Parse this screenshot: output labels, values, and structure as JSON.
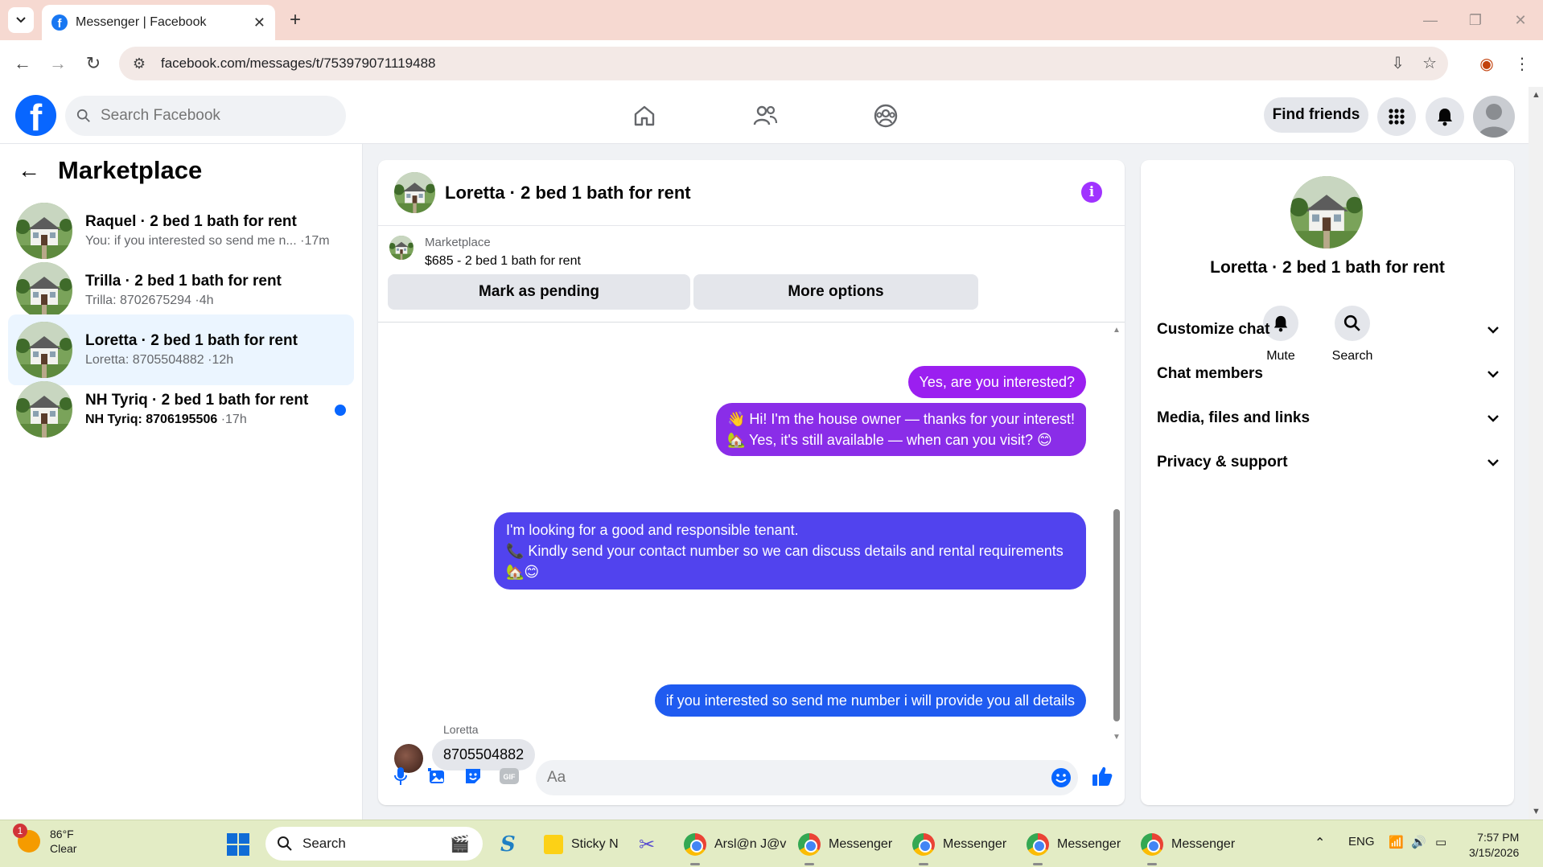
{
  "browser": {
    "tab_title": "Messenger | Facebook",
    "url": "facebook.com/messages/t/753979071119488"
  },
  "fb": {
    "search_placeholder": "Search Facebook",
    "find_friends": "Find friends"
  },
  "sidebar": {
    "title": "Marketplace",
    "conversations": [
      {
        "name": "Raquel · 2 bed 1 bath for rent",
        "snippet": "You: if you interested so send me n...",
        "time": "·17m",
        "active": false,
        "unread": false
      },
      {
        "name": "Trilla · 2 bed 1 bath for rent",
        "snippet": "Trilla: 8702675294",
        "time": "·4h",
        "active": false,
        "unread": false
      },
      {
        "name": "Loretta · 2 bed 1 bath for rent",
        "snippet": "Loretta: 8705504882",
        "time": "·12h",
        "active": true,
        "unread": false
      },
      {
        "name": "NH Tyriq · 2 bed 1 bath for rent",
        "snippet": "NH Tyriq: 8706195506",
        "time": "·17h",
        "active": false,
        "unread": true
      }
    ]
  },
  "chat": {
    "title": "Loretta · 2 bed 1 bath for rent",
    "listing_source": "Marketplace",
    "listing_price": "$685 - 2 bed 1 bath for rent",
    "mark_pending": "Mark as pending",
    "more_options": "More options",
    "messages": [
      {
        "from": "me",
        "text": "Yes, are you interested?"
      },
      {
        "from": "me",
        "lines": [
          "👋 Hi! I'm the house owner — thanks for your interest!",
          "🏡 Yes, it's still available — when can you visit? 😊"
        ]
      },
      {
        "from": "me",
        "lines": [
          "I'm looking for a good and responsible tenant.",
          "📞 Kindly send your contact number so we can discuss details and rental requirements 🏡😊"
        ]
      },
      {
        "from": "me",
        "text": "if you interested so send me number i will provide you all details"
      },
      {
        "from": "Loretta",
        "text": "8705504882"
      }
    ],
    "composer_placeholder": "Aa"
  },
  "details": {
    "title": "Loretta · 2 bed 1 bath for rent",
    "mute": "Mute",
    "search": "Search",
    "sections": [
      "Customize chat",
      "Chat members",
      "Media, files and links",
      "Privacy & support"
    ]
  },
  "taskbar": {
    "temp": "86°F",
    "condition": "Clear",
    "weather_badge": "1",
    "search": "Search",
    "apps": [
      "Sticky N",
      "Arsl@n J@v",
      "Messenger",
      "Messenger",
      "Messenger",
      "Messenger"
    ],
    "lang": "ENG",
    "time": "7:57 PM",
    "date": "3/15/2026"
  },
  "colors": {
    "fb_blue": "#0866ff",
    "active_row": "#ebf5ff",
    "bubble_purple": "#9b1ff0",
    "bubble_blue": "#1f5bf0",
    "info_purple": "#a033ff"
  }
}
